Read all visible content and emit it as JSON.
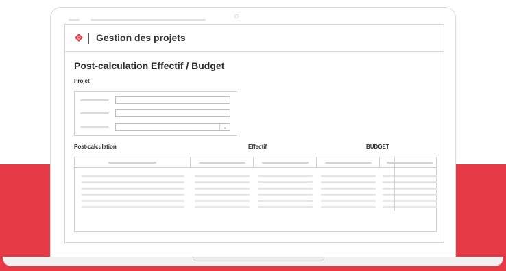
{
  "app": {
    "title": "Gestion des projets",
    "logo_icon": "diamond-logo-icon",
    "accent_color": "#e63946"
  },
  "page": {
    "title": "Post-calculation Effectif / Budget"
  },
  "project_section": {
    "label": "Projet",
    "fields": [
      {
        "type": "text",
        "value": ""
      },
      {
        "type": "text",
        "value": ""
      },
      {
        "type": "select",
        "value": "",
        "icon": "chevron-down-icon"
      }
    ]
  },
  "table_section": {
    "labels": {
      "post_calculation": "Post-calculation",
      "effectif": "Effectif",
      "budget": "BUDGET"
    },
    "columns": 5,
    "rows": 6
  }
}
